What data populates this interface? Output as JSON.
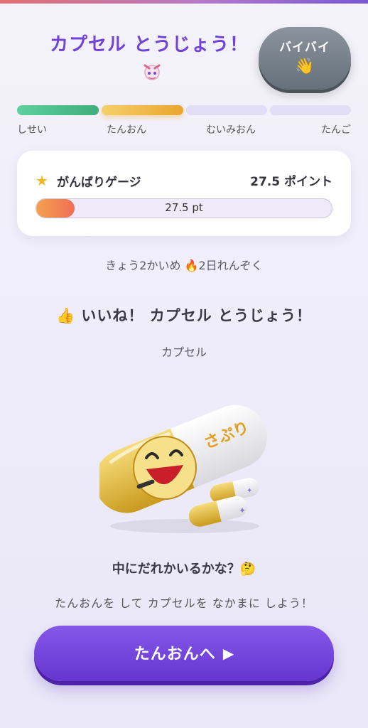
{
  "header": {
    "title": "カプセル とうじょう！",
    "bye_button_label": "バイバイ",
    "bye_button_icon": "waving-hand-icon"
  },
  "steps": [
    {
      "label": "しせい",
      "state": "done",
      "color": "#4fbf8b"
    },
    {
      "label": "たんおん",
      "state": "current",
      "color": "#f0b63c"
    },
    {
      "label": "むいみおん",
      "state": "upcoming",
      "color": "#e2def5"
    },
    {
      "label": "たんご",
      "state": "upcoming",
      "color": "#e2def5"
    }
  ],
  "gauge": {
    "title": "がんばりゲージ",
    "points_text": "27.5 ポイント",
    "bar_text": "27.5 pt",
    "progress_percent": 13
  },
  "streak": {
    "text_before": "きょう2かいめ ",
    "fire_icon": "🔥",
    "text_after": "2日れんぞく"
  },
  "result": {
    "icon": "👍",
    "text": "いいね！ カプセル とうじょう！",
    "capsule_name": "カプセル",
    "capsule_brand_text": "さぷり"
  },
  "question": "中にだれかいるかな？🤔",
  "hint": "たんおんを して カプセルを なかまに しよう！",
  "cta": {
    "label": "たんおんへ",
    "arrow": "▶"
  },
  "colors": {
    "accent": "#6f43d6",
    "cta": "#6635d1",
    "bye": "#6d767f"
  }
}
